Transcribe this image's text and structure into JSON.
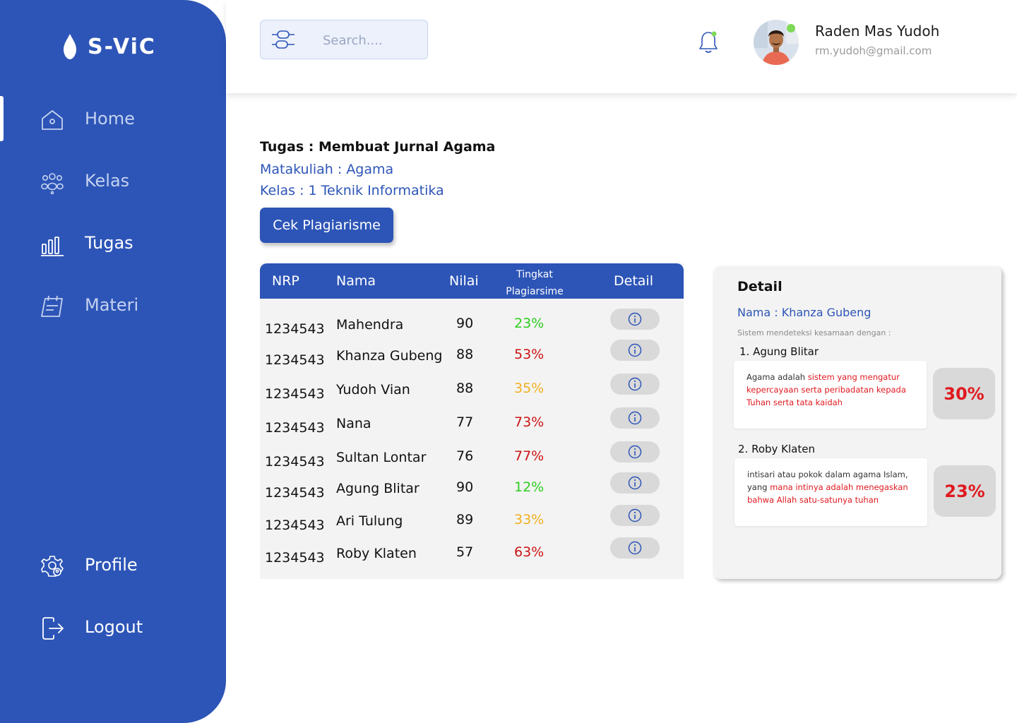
{
  "app": {
    "name": "S-ViC"
  },
  "sidebar": {
    "items": [
      {
        "label": "Home",
        "icon": "home-icon"
      },
      {
        "label": "Kelas",
        "icon": "users-icon"
      },
      {
        "label": "Tugas",
        "icon": "chart-bars-icon"
      },
      {
        "label": "Materi",
        "icon": "calendar-note-icon"
      },
      {
        "label": "Profile",
        "icon": "gear-profile-icon"
      },
      {
        "label": "Logout",
        "icon": "logout-icon"
      }
    ]
  },
  "header": {
    "search_placeholder": "Search....",
    "user": {
      "name": "Raden Mas Yudoh",
      "email": "rm.yudoh@gmail.com"
    }
  },
  "task": {
    "title": "Tugas : Membuat Jurnal Agama",
    "course": "Matakuliah : Agama",
    "class": "Kelas : 1 Teknik Informatika",
    "check_button": "Cek Plagiarisme"
  },
  "table": {
    "headers": {
      "nrp": "NRP",
      "nama": "Nama",
      "nilai": "Nilai",
      "tingkat_1": "Tingkat",
      "tingkat_2": "Plagiarsime",
      "detail": "Detail"
    },
    "rows": [
      {
        "nrp": "1234543",
        "nama": "Mahendra",
        "nilai": "90",
        "plagiarism": "23%",
        "color": "#2ecc1f"
      },
      {
        "nrp": "1234543",
        "nama": "Khanza Gubeng",
        "nilai": "88",
        "plagiarism": "53%",
        "color": "#cc1414"
      },
      {
        "nrp": "1234543",
        "nama": "Yudoh Vian",
        "nilai": "88",
        "plagiarism": "35%",
        "color": "#f2b01e"
      },
      {
        "nrp": "1234543",
        "nama": "Nana",
        "nilai": "77",
        "plagiarism": "73%",
        "color": "#cc1414"
      },
      {
        "nrp": "1234543",
        "nama": "Sultan Lontar",
        "nilai": "76",
        "plagiarism": "77%",
        "color": "#cc1414"
      },
      {
        "nrp": "1234543",
        "nama": "Agung Blitar",
        "nilai": "90",
        "plagiarism": "12%",
        "color": "#2ecc1f"
      },
      {
        "nrp": "1234543",
        "nama": "Ari Tulung",
        "nilai": "89",
        "plagiarism": "33%",
        "color": "#f2b01e"
      },
      {
        "nrp": "1234543",
        "nama": "Roby Klaten",
        "nilai": "57",
        "plagiarism": "63%",
        "color": "#cc1414"
      }
    ]
  },
  "detail": {
    "title": "Detail",
    "nama": "Nama : Khanza Gubeng",
    "note": "Sistem mendeteksi kesamaan dengan :",
    "matches": [
      {
        "title": "1. Agung Blitar",
        "text_plain": "Agama adalah ",
        "text_highlight": "sistem yang mengatur kepercayaan serta peribadatan kepada Tuhan serta tata kaidah",
        "percent": "30%"
      },
      {
        "title": "2. Roby Klaten",
        "text_plain": "intisari atau pokok dalam agama Islam, yang ",
        "text_highlight": "mana intinya adalah menegaskan bahwa Allah satu-satunya tuhan",
        "percent": "23%"
      }
    ]
  },
  "colors": {
    "primary": "#2d55b7",
    "danger": "#cc1414",
    "warning": "#f2b01e",
    "success": "#2ecc1f"
  }
}
